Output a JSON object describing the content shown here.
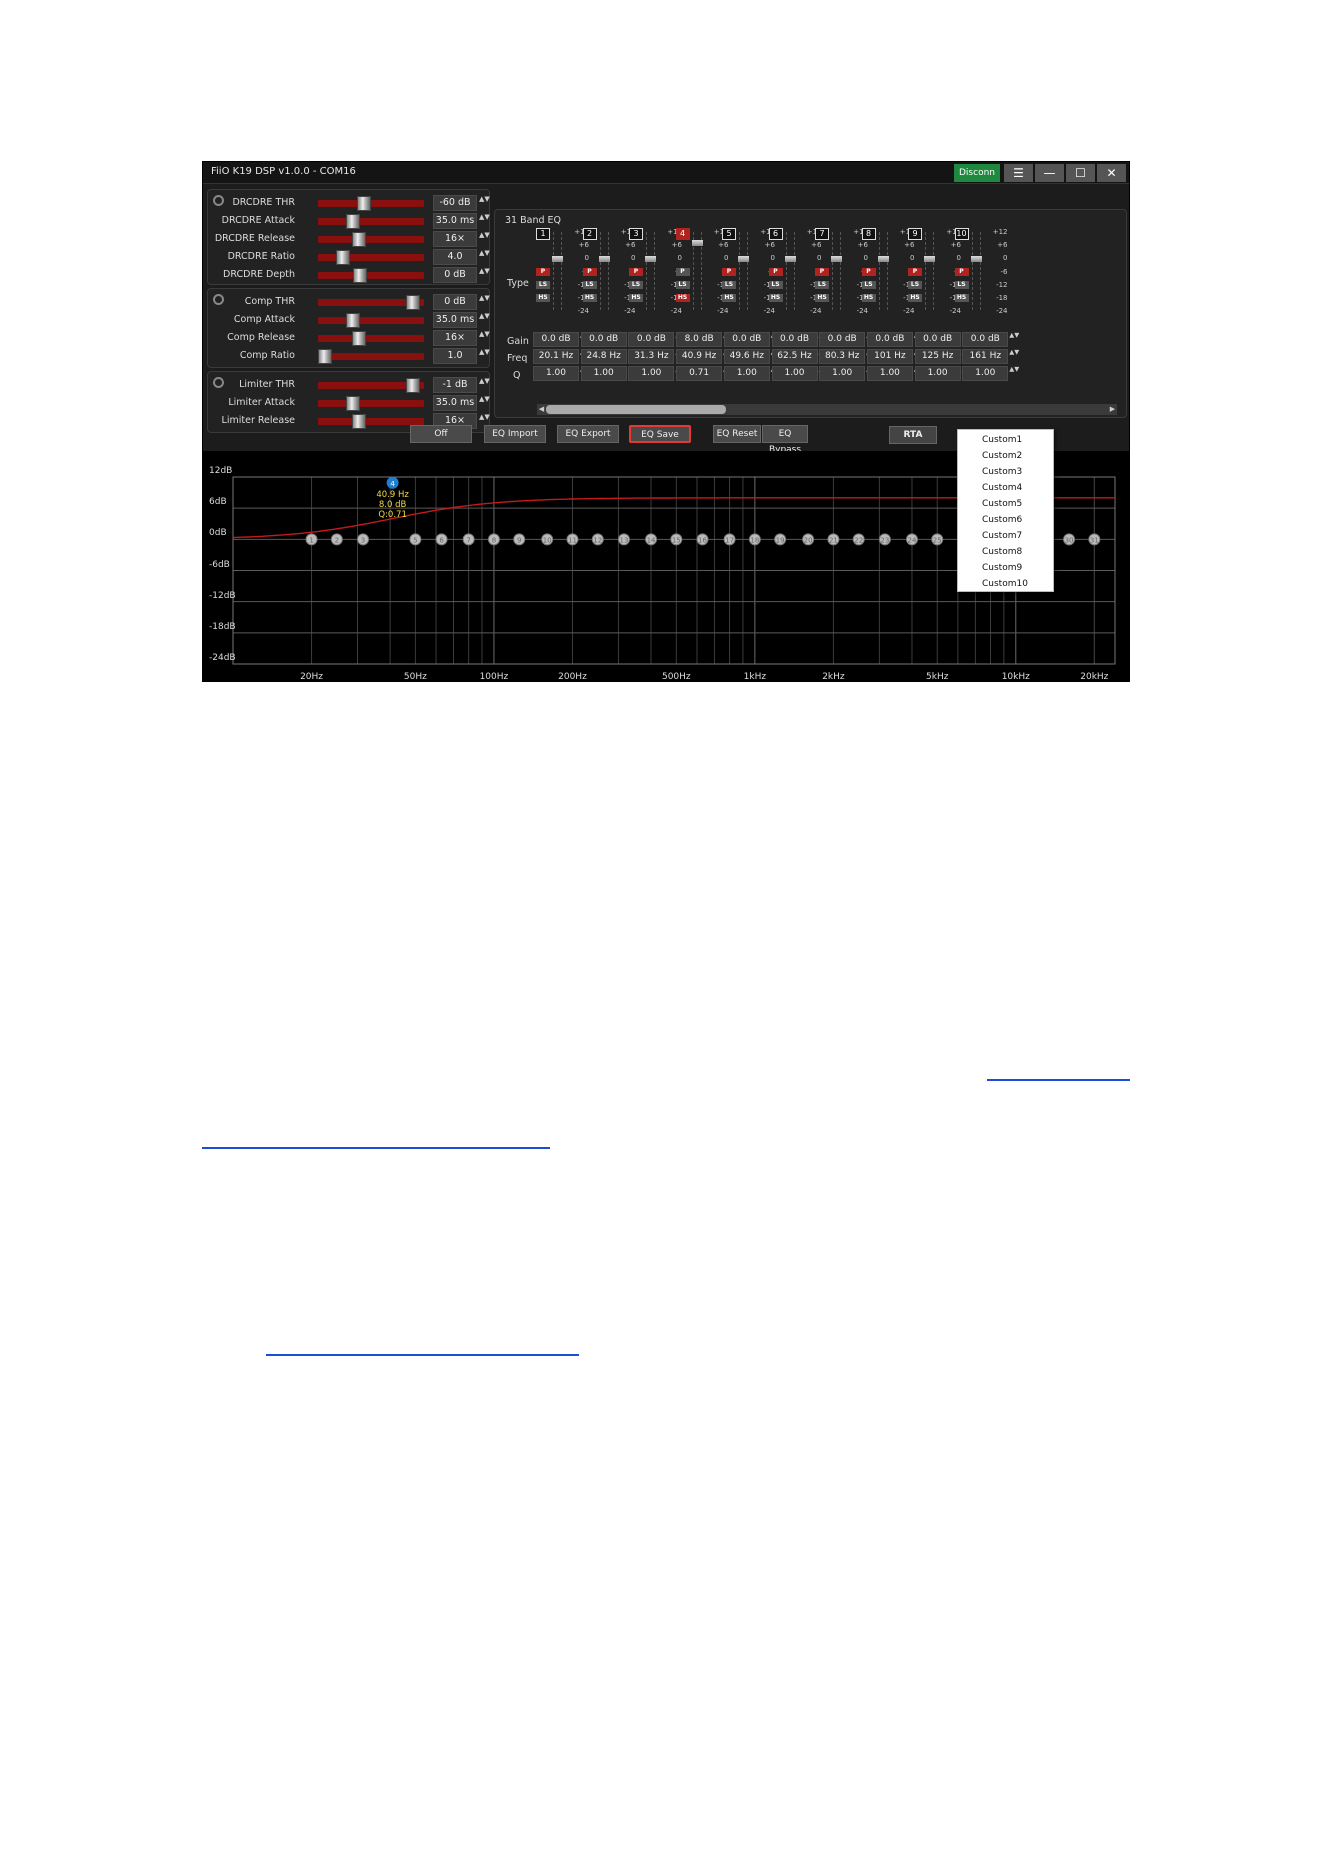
{
  "window": {
    "title": "FiiO K19 DSP v1.0.0 - COM16",
    "disconn_label": "Disconn",
    "menu_icon": "☰",
    "min_icon": "—",
    "max_icon": "☐",
    "close_icon": "✕"
  },
  "drc": [
    {
      "label": "DRCDRE THR",
      "value": "-60 dB",
      "level": 0.42
    },
    {
      "label": "DRCDRE Attack",
      "value": "35.0 ms",
      "level": 0.3
    },
    {
      "label": "DRCDRE Release",
      "value": "16×",
      "level": 0.37
    },
    {
      "label": "DRCDRE Ratio",
      "value": "4.0",
      "level": 0.2
    },
    {
      "label": "DRCDRE Depth",
      "value": "0 dB",
      "level": 0.38
    }
  ],
  "comp": [
    {
      "label": "Comp THR",
      "value": "0 dB",
      "level": 0.96
    },
    {
      "label": "Comp Attack",
      "value": "35.0 ms",
      "level": 0.3
    },
    {
      "label": "Comp Release",
      "value": "16×",
      "level": 0.37
    },
    {
      "label": "Comp Ratio",
      "value": "1.0",
      "level": 0.0
    }
  ],
  "limiter": [
    {
      "label": "Limiter THR",
      "value": "-1 dB",
      "level": 0.96
    },
    {
      "label": "Limiter Attack",
      "value": "35.0 ms",
      "level": 0.3
    },
    {
      "label": "Limiter Release",
      "value": "16×",
      "level": 0.37
    }
  ],
  "eq": {
    "title": "31 Band EQ",
    "type_label": "Type",
    "gain_label": "Gain",
    "freq_label": "Freq",
    "q_label": "Q",
    "scale": [
      "+12",
      "+6",
      "0",
      "-6",
      "-12",
      "-18",
      "-24"
    ],
    "type_options": [
      "P",
      "LS",
      "HS"
    ],
    "bands": [
      {
        "num": "1",
        "gain": "0.0 dB",
        "freq": "20.1 Hz",
        "q": "1.00",
        "type": "P",
        "gain_db": 0
      },
      {
        "num": "2",
        "gain": "0.0 dB",
        "freq": "24.8 Hz",
        "q": "1.00",
        "type": "P",
        "gain_db": 0
      },
      {
        "num": "3",
        "gain": "0.0 dB",
        "freq": "31.3 Hz",
        "q": "1.00",
        "type": "P",
        "gain_db": 0
      },
      {
        "num": "4",
        "gain": "8.0 dB",
        "freq": "40.9 Hz",
        "q": "0.71",
        "type": "HS",
        "gain_db": 8,
        "active": true
      },
      {
        "num": "5",
        "gain": "0.0 dB",
        "freq": "49.6 Hz",
        "q": "1.00",
        "type": "P",
        "gain_db": 0
      },
      {
        "num": "6",
        "gain": "0.0 dB",
        "freq": "62.5 Hz",
        "q": "1.00",
        "type": "P",
        "gain_db": 0
      },
      {
        "num": "7",
        "gain": "0.0 dB",
        "freq": "80.3 Hz",
        "q": "1.00",
        "type": "P",
        "gain_db": 0
      },
      {
        "num": "8",
        "gain": "0.0 dB",
        "freq": "101 Hz",
        "q": "1.00",
        "type": "P",
        "gain_db": 0
      },
      {
        "num": "9",
        "gain": "0.0 dB",
        "freq": "125 Hz",
        "q": "1.00",
        "type": "P",
        "gain_db": 0
      },
      {
        "num": "10",
        "gain": "0.0 dB",
        "freq": "161 Hz",
        "q": "1.00",
        "type": "P",
        "gain_db": 0
      }
    ]
  },
  "buttons": {
    "off": "Off",
    "import": "EQ Import",
    "export": "EQ Export",
    "save": "EQ Save",
    "reset": "EQ Reset",
    "bypass": "EQ Bypass",
    "rta": "RTA"
  },
  "save_menu": [
    "Custom1",
    "Custom2",
    "Custom3",
    "Custom4",
    "Custom5",
    "Custom6",
    "Custom7",
    "Custom8",
    "Custom9",
    "Custom10"
  ],
  "graph": {
    "y_labels": [
      "12dB",
      "6dB",
      "0dB",
      "-6dB",
      "-12dB",
      "-18dB",
      "-24dB"
    ],
    "x_labels": [
      "20Hz",
      "50Hz",
      "100Hz",
      "200Hz",
      "500Hz",
      "1kHz",
      "2kHz",
      "5kHz",
      "10kHz",
      "20kHz"
    ],
    "x_values": [
      20,
      50,
      100,
      200,
      500,
      1000,
      2000,
      5000,
      10000,
      20000
    ],
    "ylim": [
      -24,
      12
    ],
    "xlim": [
      10,
      24000
    ],
    "curve_color": "#c41a1a",
    "selected_band": {
      "num": "4",
      "freq": "40.9 Hz",
      "gain": "8.0 dB",
      "q": "Q:0.71",
      "freq_hz": 40.9,
      "gain_db": 8
    },
    "band_freqs": [
      20,
      25,
      31.5,
      40,
      50,
      63,
      80,
      100,
      125,
      160,
      200,
      250,
      315,
      400,
      500,
      630,
      800,
      1000,
      1250,
      1600,
      2000,
      2500,
      3150,
      4000,
      5000,
      6300,
      8000,
      10000,
      12500,
      16000,
      20000
    ],
    "band_gains": [
      0,
      0,
      0,
      8,
      0,
      0,
      0,
      0,
      0,
      0,
      0,
      0,
      0,
      0,
      0,
      0,
      0,
      0,
      0,
      0,
      0,
      0,
      0,
      0,
      0,
      0,
      0,
      0,
      0,
      0,
      0
    ]
  }
}
